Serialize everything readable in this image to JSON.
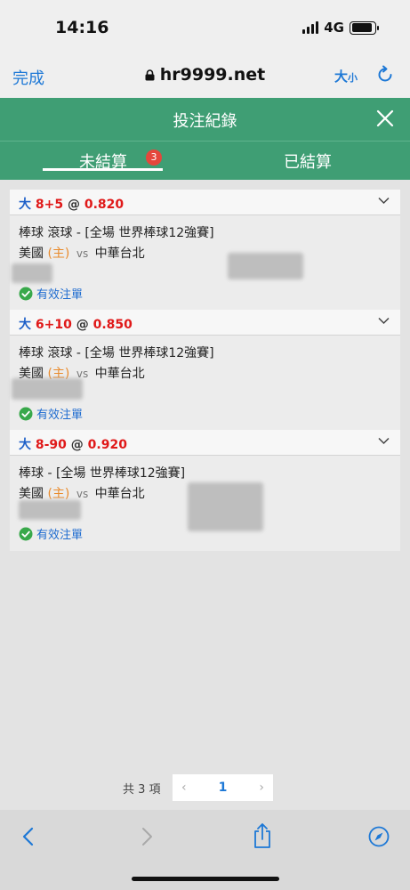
{
  "status_bar": {
    "time": "14:16",
    "network": "4G",
    "battery_level": 0.9
  },
  "browser": {
    "done_label": "完成",
    "url": "hr9999.net",
    "text_size_label": "大",
    "text_size_small": "小"
  },
  "modal": {
    "title": "投注紀錄"
  },
  "tabs": {
    "unsettled_label": "未結算",
    "unsettled_count": "3",
    "settled_label": "已結算"
  },
  "bets": [
    {
      "type": "大",
      "line": "8+5",
      "at": "@",
      "odds": "0.820",
      "match": "棒球 滾球 - [全場 世界棒球12強賽]",
      "home": "美國",
      "home_tag": "(主)",
      "vs": "vs",
      "away": "中華台北",
      "status": "有效注單"
    },
    {
      "type": "大",
      "line": "6+10",
      "at": "@",
      "odds": "0.850",
      "match": "棒球 滾球 - [全場 世界棒球12強賽]",
      "home": "美國",
      "home_tag": "(主)",
      "vs": "vs",
      "away": "中華台北",
      "status": "有效注單"
    },
    {
      "type": "大",
      "line": "8-90",
      "at": "@",
      "odds": "0.920",
      "match": "棒球 - [全場 世界棒球12強賽]",
      "home": "美國",
      "home_tag": "(主)",
      "vs": "vs",
      "away": "中華台北",
      "status": "有效注單"
    }
  ],
  "pagination": {
    "total": "共 3 項",
    "prev": "‹",
    "page": "1",
    "next": "›"
  },
  "colors": {
    "header_green": "#3f9e74",
    "badge_red": "#e5473c",
    "link_blue": "#1d78d6",
    "odds_red": "#e01919"
  }
}
